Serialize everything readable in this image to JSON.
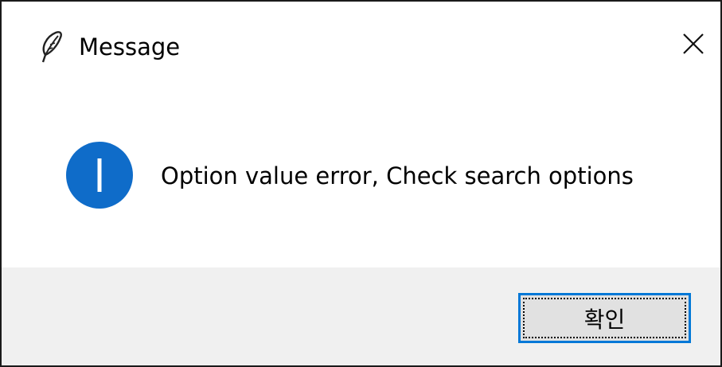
{
  "window": {
    "title": "Message",
    "app_icon": "feather-icon",
    "close_icon": "close-icon"
  },
  "message": {
    "icon": "info-icon",
    "text": "Option value error, Check search options"
  },
  "buttons": {
    "ok_label": "확인"
  },
  "colors": {
    "info_icon_fill": "#0f6cc9",
    "button_focus_border": "#0078d7",
    "footer_background": "#f0f0f0",
    "button_background": "#e1e1e1"
  }
}
